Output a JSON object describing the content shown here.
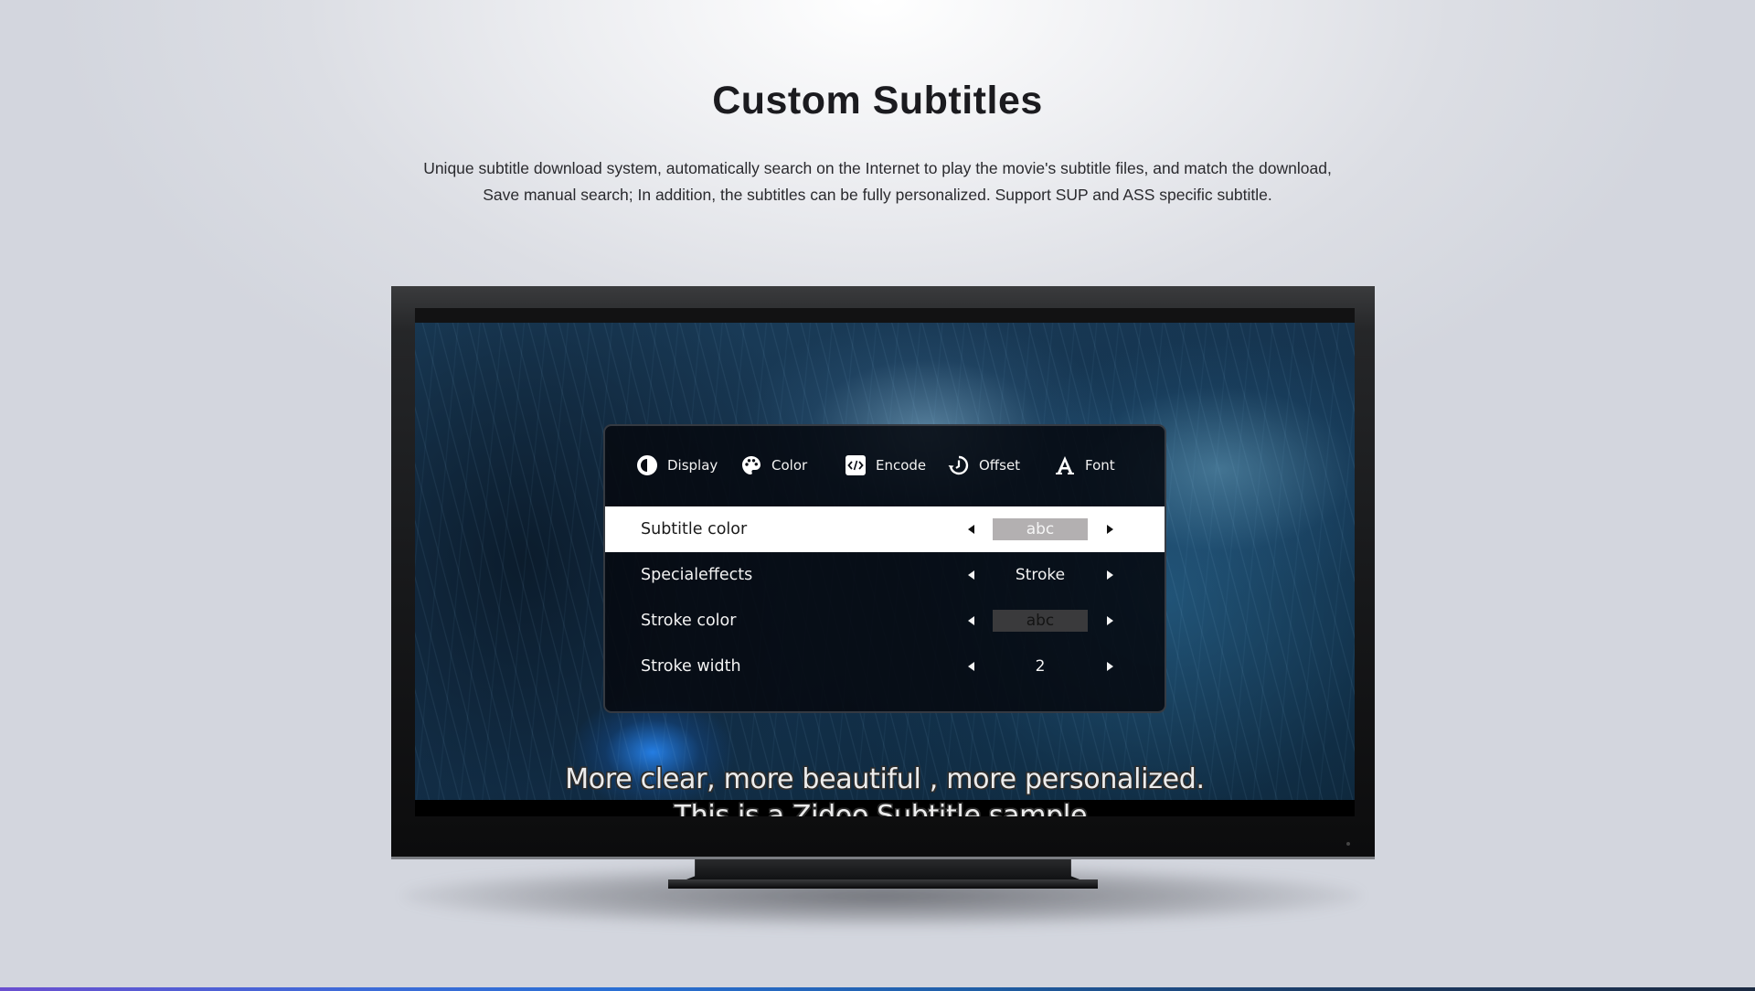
{
  "header": {
    "title": "Custom Subtitles",
    "description_lines": [
      "Unique subtitle download system, automatically search on the Internet to play the movie's subtitle files, and match the download,",
      "Save manual search; In addition, the subtitles can be fully personalized. Support SUP and ASS specific subtitle."
    ]
  },
  "subtitle_menu": {
    "tabs": [
      {
        "label": "Display",
        "icon": "half-circle-contrast-icon"
      },
      {
        "label": "Color",
        "icon": "palette-icon"
      },
      {
        "label": "Encode",
        "icon": "code-icon"
      },
      {
        "label": "Offset",
        "icon": "clock-rewind-icon"
      },
      {
        "label": "Font",
        "icon": "font-letter-a-icon"
      }
    ],
    "rows": [
      {
        "label": "Subtitle color",
        "value": "abc",
        "value_type": "color-swatch",
        "swatch_color": "#b3b0b1",
        "selected": true
      },
      {
        "label": "Specialeffects",
        "value": "Stroke",
        "value_type": "text",
        "selected": false
      },
      {
        "label": "Stroke color",
        "value": "abc",
        "value_type": "color-swatch",
        "swatch_color": "#3a3a3c",
        "selected": false
      },
      {
        "label": "Stroke width",
        "value": "2",
        "value_type": "text",
        "selected": false
      }
    ]
  },
  "subtitle_sample": {
    "line1": "More clear, more beautiful , more personalized.",
    "line2": "This is a Zidoo Subtitle sample."
  },
  "colors": {
    "selected_row_bg": "#ffffff",
    "panel_bg": "#06090f",
    "bottom_bar_gradient": [
      "#6a4fd0",
      "#2a6fd4",
      "#1b2a42"
    ]
  }
}
